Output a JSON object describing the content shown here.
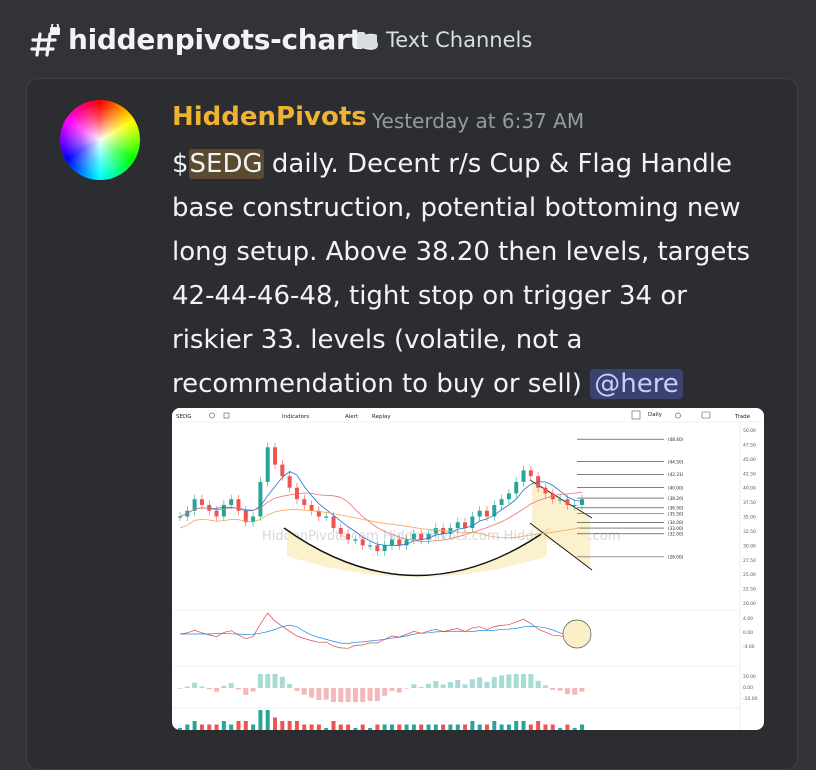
{
  "channel": {
    "name": "hiddenpivots-charts",
    "category": "Text Channels",
    "hash_icon": "hashtag-lock-icon",
    "folder_icon": "folder-icon"
  },
  "message": {
    "author": "HiddenPivots",
    "author_color": "#f0b232",
    "timestamp": "Yesterday at 6:37 AM",
    "text_prefix": "$",
    "ticker": "SEDG",
    "text_body": " daily. Decent r/s Cup & Flag Handle base construction, potential bottoming new long setup. Above 38.20 then levels, targets 42-44-46-48, tight stop on trigger 34 or riskier 33. levels (volatile, not a recommendation to buy or sell) ",
    "mention": "@here"
  },
  "chart_toolbar": {
    "symbol": "SEDG",
    "indicators": "Indicators",
    "alert": "Alert",
    "replay": "Replay",
    "interval": "Daily",
    "trade": "Trade"
  },
  "chart_data": {
    "type": "line",
    "watermark": "HiddenPivots.com",
    "price_axis_ticks": [
      "50.00",
      "47.50",
      "45.00",
      "42.50",
      "40.00",
      "37.50",
      "35.00",
      "32.50",
      "30.00",
      "27.50",
      "25.00",
      "22.50",
      "20.00"
    ],
    "levels": [
      {
        "value": 48.4,
        "label": "(48.40)"
      },
      {
        "value": 44.5,
        "label": "(44.50)"
      },
      {
        "value": 42.3,
        "label": "(42.31)"
      },
      {
        "value": 40.0,
        "label": "(40.00)"
      },
      {
        "value": 38.2,
        "label": "(38.20)"
      },
      {
        "value": 36.5,
        "label": "(36.50)"
      },
      {
        "value": 35.5,
        "label": "(35.50)"
      },
      {
        "value": 34.0,
        "label": "(34.00)"
      },
      {
        "value": 33.0,
        "label": "(33.00)"
      },
      {
        "value": 32.0,
        "label": "(32.00)"
      },
      {
        "value": 28.0,
        "label": "(28.00)"
      }
    ],
    "price_series": [
      35,
      36,
      38,
      37,
      36,
      35,
      37,
      38,
      36,
      34,
      35,
      41,
      47,
      44,
      42,
      40,
      38,
      37,
      36,
      35,
      35,
      33,
      32,
      31,
      31,
      30,
      30,
      29,
      30,
      31,
      30,
      31,
      32,
      31,
      32,
      33,
      32,
      33,
      34,
      33,
      35,
      36,
      35,
      37,
      38,
      39,
      41,
      43,
      42,
      40,
      39,
      38,
      38,
      37,
      37,
      38
    ],
    "osc_ticks": [
      "4.00",
      "0.00",
      "-4.00"
    ],
    "hist_ticks": [
      "20.00",
      "0.00",
      "-20.00"
    ]
  }
}
